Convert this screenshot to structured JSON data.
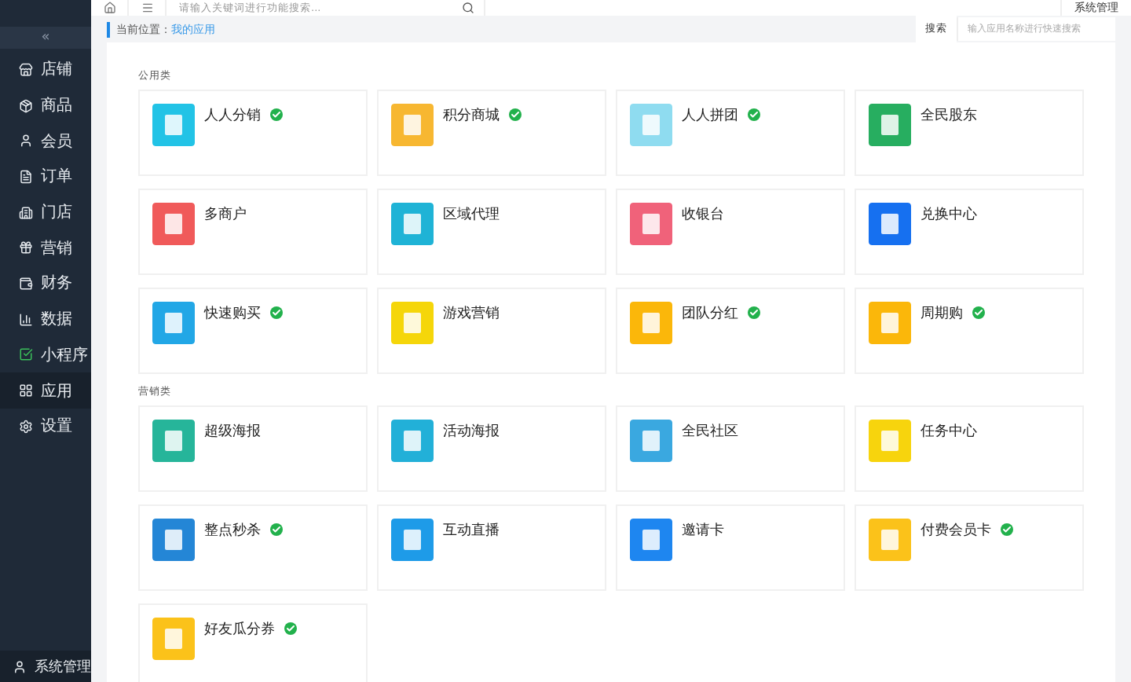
{
  "sidebar": {
    "collapse_icon": "«",
    "items": [
      {
        "label": "店铺",
        "selected": false
      },
      {
        "label": "商品",
        "selected": false
      },
      {
        "label": "会员",
        "selected": false
      },
      {
        "label": "订单",
        "selected": false
      },
      {
        "label": "门店",
        "selected": false
      },
      {
        "label": "营销",
        "selected": false
      },
      {
        "label": "财务",
        "selected": false
      },
      {
        "label": "数据",
        "selected": false
      },
      {
        "label": "小程序",
        "selected": false
      },
      {
        "label": "应用",
        "selected": true
      },
      {
        "label": "设置",
        "selected": false
      }
    ],
    "footer": "系统管理"
  },
  "topbar": {
    "search": {
      "placeholder": "请输入关键词进行功能搜索..."
    },
    "user": "系统管理"
  },
  "breadcrumb": {
    "label": "当前位置：",
    "current": "我的应用"
  },
  "app_search": {
    "label": "搜索",
    "placeholder": "输入应用名称进行快速搜索"
  },
  "sections": [
    {
      "title": "公用类",
      "apps": [
        {
          "name": "人人分销",
          "installed": true,
          "color": "#22c3e6"
        },
        {
          "name": "积分商城",
          "installed": true,
          "color": "#f7b731"
        },
        {
          "name": "人人拼团",
          "installed": true,
          "color": "#8fdcf0"
        },
        {
          "name": "全民股东",
          "installed": false,
          "color": "#27ae60"
        },
        {
          "name": "多商户",
          "installed": false,
          "color": "#f05a5a"
        },
        {
          "name": "区域代理",
          "installed": false,
          "color": "#1fb3d6"
        },
        {
          "name": "收银台",
          "installed": false,
          "color": "#f0627a"
        },
        {
          "name": "兑换中心",
          "installed": false,
          "color": "#1670f0"
        },
        {
          "name": "快速购买",
          "installed": true,
          "color": "#22a7e6"
        },
        {
          "name": "游戏营销",
          "installed": false,
          "color": "#f5d60a"
        },
        {
          "name": "团队分红",
          "installed": true,
          "color": "#fbb70a"
        },
        {
          "name": "周期购",
          "installed": true,
          "color": "#fbb70a"
        }
      ]
    },
    {
      "title": "营销类",
      "apps": [
        {
          "name": "超级海报",
          "installed": false,
          "color": "#26b59a"
        },
        {
          "name": "活动海报",
          "installed": false,
          "color": "#22b0d8"
        },
        {
          "name": "全民社区",
          "installed": false,
          "color": "#3aa8e0"
        },
        {
          "name": "任务中心",
          "installed": false,
          "color": "#f7d40d"
        },
        {
          "name": "整点秒杀",
          "installed": true,
          "color": "#2486d6"
        },
        {
          "name": "互动直播",
          "installed": false,
          "color": "#1e9be8"
        },
        {
          "name": "邀请卡",
          "installed": false,
          "color": "#1e86f0"
        },
        {
          "name": "付费会员卡",
          "installed": true,
          "color": "#fbc21a"
        },
        {
          "name": "好友瓜分券",
          "installed": true,
          "color": "#fbc21a"
        }
      ]
    }
  ]
}
